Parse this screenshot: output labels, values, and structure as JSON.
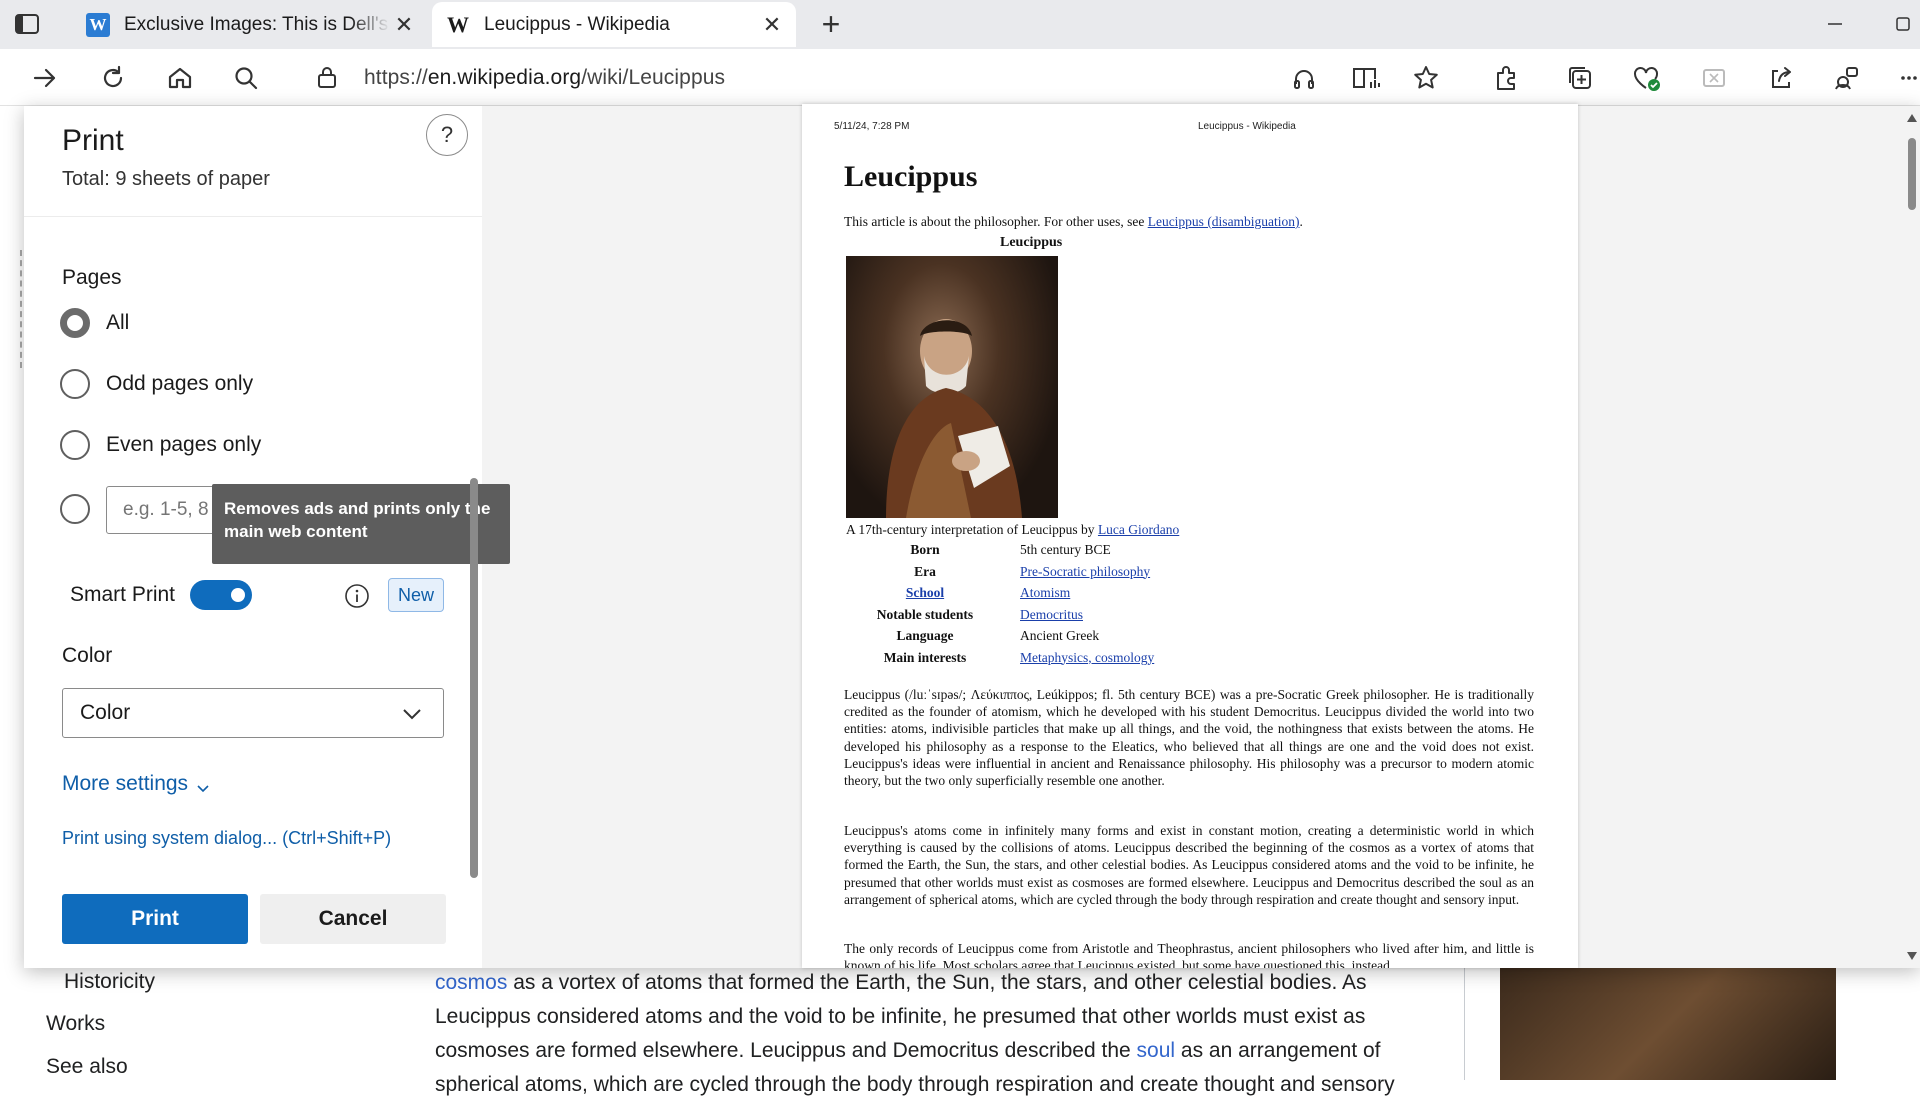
{
  "browser": {
    "tabs": [
      {
        "label": "Exclusive Images: This is Dell's upcoming",
        "favicon": "W"
      },
      {
        "label": "Leucippus - Wikipedia",
        "favicon": "W"
      }
    ],
    "new_tab": "+",
    "url_prefix": "https://",
    "url_host": "en.wikipedia.org",
    "url_path": "/wiki/Leucippus"
  },
  "wiki_page": {
    "nav_items": [
      "Historicity",
      "Works",
      "See also"
    ],
    "text_link1": "cosmos",
    "text_line1": " as a vortex of atoms that formed the Earth, the Sun, the stars, and other celestial bodies. As",
    "text_line2": "Leucippus considered atoms and the void to be infinite, he presumed that other worlds must exist as",
    "text_line3a": "cosmoses are formed elsewhere. Leucippus and Democritus described the ",
    "text_link2": "soul",
    "text_line3b": " as an arrangement of",
    "text_line4": "spherical atoms, which are cycled through the body through respiration and create thought and sensory"
  },
  "print_panel": {
    "title": "Print",
    "total": "Total: 9 sheets of paper",
    "help": "?",
    "pages_heading": "Pages",
    "page_options": [
      "All",
      "Odd pages only",
      "Even pages only"
    ],
    "selected_page_option": "All",
    "range_placeholder": "e.g. 1-5, 8",
    "tooltip": "Removes ads and prints only the main web content",
    "smart_print_label": "Smart Print",
    "smart_print_on": true,
    "new_badge": "New",
    "color_heading": "Color",
    "color_value": "Color",
    "more_settings": "More settings",
    "system_dialog": "Print using system dialog... (Ctrl+Shift+P)",
    "print_button": "Print",
    "cancel_button": "Cancel",
    "accent_color": "#0f6cbd"
  },
  "preview": {
    "header_left": "5/11/24, 7:28 PM",
    "header_center": "Leucippus - Wikipedia",
    "title": "Leucippus",
    "hatnote": "This article is about the philosopher. For other uses, see ",
    "hatnote_link": "Leucippus (disambiguation)",
    "hatnote_end": ".",
    "infobox_title": "Leucippus",
    "caption": "A 17th-century interpretation of Leucippus by ",
    "caption_link": "Luca Giordano",
    "infobox": [
      {
        "k": "Born",
        "v": "5th century BCE",
        "link": false
      },
      {
        "k": "Era",
        "v": "Pre-Socratic philosophy",
        "link": true
      },
      {
        "k": "School",
        "v": "Atomism",
        "link": true
      },
      {
        "k": "Notable students",
        "v": "Democritus",
        "link": true
      },
      {
        "k": "Language",
        "v": "Ancient Greek",
        "link": false
      },
      {
        "k": "Main interests",
        "v": "Metaphysics, cosmology",
        "link": true
      }
    ],
    "para1": "Leucippus (/luːˈsɪpəs/; Λεύκιππος, Leúkippos; fl. 5th century BCE) was a pre-Socratic Greek philosopher. He is traditionally credited as the founder of atomism, which he developed with his student Democritus. Leucippus divided the world into two entities: atoms, indivisible particles that make up all things, and the void, the nothingness that exists between the atoms. He developed his philosophy as a response to the Eleatics, who believed that all things are one and the void does not exist. Leucippus's ideas were influential in ancient and Renaissance philosophy. His philosophy was a precursor to modern atomic theory, but the two only superficially resemble one another.",
    "para2": "Leucippus's atoms come in infinitely many forms and exist in constant motion, creating a deterministic world in which everything is caused by the collisions of atoms. Leucippus described the beginning of the cosmos as a vortex of atoms that formed the Earth, the Sun, the stars, and other celestial bodies. As Leucippus considered atoms and the void to be infinite, he presumed that other worlds must exist as cosmoses are formed elsewhere. Leucippus and Democritus described the soul as an arrangement of spherical atoms, which are cycled through the body through respiration and create thought and sensory input.",
    "para3": "The only records of Leucippus come from Aristotle and Theophrastus, ancient philosophers who lived after him, and little is known of his life. Most scholars agree that Leucippus existed, but some have questioned this, instead"
  }
}
